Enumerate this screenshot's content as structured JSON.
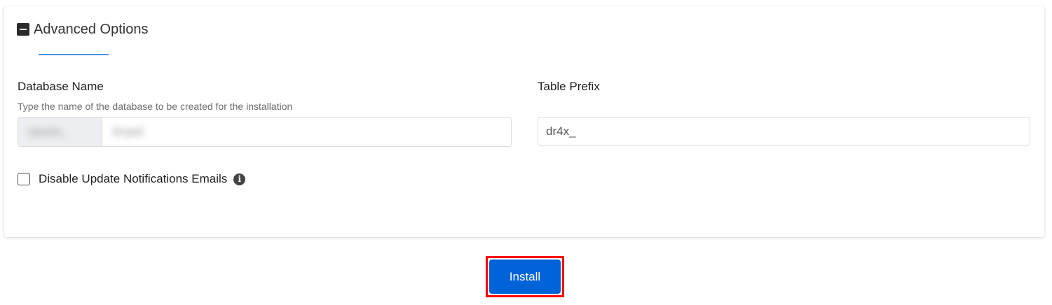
{
  "advanced_options": {
    "title": "Advanced Options",
    "toggle_icon": "minus-square-icon"
  },
  "database_name": {
    "label": "Database Name",
    "help": "Type the name of the database to be created for the installation",
    "prefix_value": "cpuser_",
    "value": "drupal"
  },
  "table_prefix": {
    "label": "Table Prefix",
    "value": "dr4x_"
  },
  "disable_update_notifications": {
    "label": "Disable Update Notifications Emails",
    "checked": false,
    "info_icon": "info-circle-icon"
  },
  "install_button": {
    "label": "Install"
  },
  "colors": {
    "accent": "#4a90e2",
    "button": "#0063d8",
    "highlight_outline": "#ff0000"
  }
}
